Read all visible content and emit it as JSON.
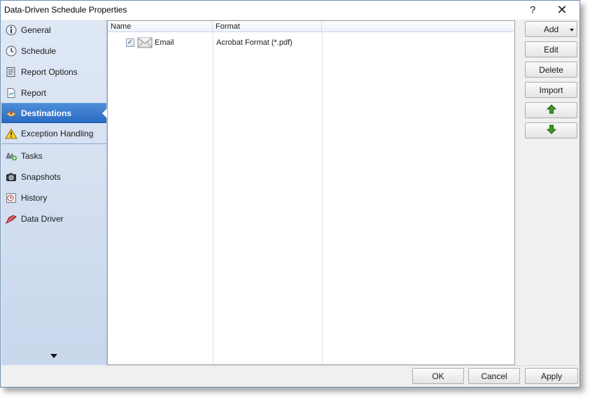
{
  "window": {
    "title": "Data-Driven Schedule Properties",
    "help_label": "?",
    "close_label": "✕"
  },
  "sidebar": {
    "items": [
      {
        "label": "General",
        "icon": "info-icon"
      },
      {
        "label": "Schedule",
        "icon": "clock-icon"
      },
      {
        "label": "Report Options",
        "icon": "report-options-icon"
      },
      {
        "label": "Report",
        "icon": "report-icon"
      },
      {
        "label": "Destinations",
        "icon": "destinations-icon",
        "active": true
      },
      {
        "label": "Exception Handling",
        "icon": "warning-icon"
      },
      {
        "label": "Tasks",
        "icon": "tasks-icon"
      },
      {
        "label": "Snapshots",
        "icon": "camera-icon"
      },
      {
        "label": "History",
        "icon": "history-icon"
      },
      {
        "label": "Data Driver",
        "icon": "data-driver-icon"
      }
    ]
  },
  "list": {
    "columns": [
      "Name",
      "Format",
      ""
    ],
    "rows": [
      {
        "checked": true,
        "check_mark": "✓",
        "icon": "envelope-icon",
        "name": "Email",
        "format": "Acrobat Format (*.pdf)"
      }
    ]
  },
  "actions": {
    "add": "Add",
    "edit": "Edit",
    "delete": "Delete",
    "import": "Import",
    "move_up_icon": "green-up-arrow-icon",
    "move_down_icon": "green-down-arrow-icon"
  },
  "footer": {
    "ok": "OK",
    "cancel": "Cancel",
    "apply": "Apply"
  },
  "colors": {
    "active_nav": "#2a6bc2",
    "sidebar_bg": "#d4e0f0",
    "arrow_green": "#3a9a2a"
  }
}
